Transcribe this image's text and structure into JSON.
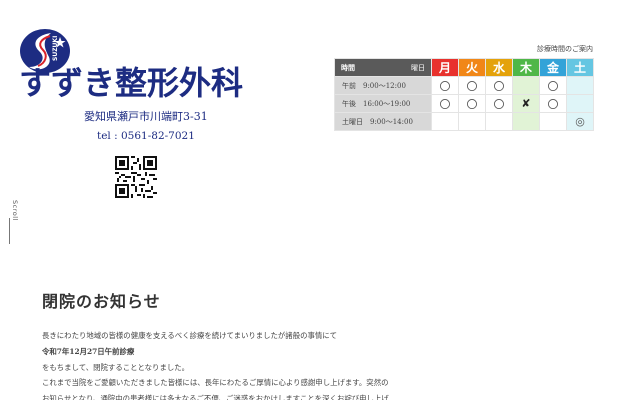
{
  "header": {
    "logo_text": "SUZUKI",
    "clinic_name": "すずき整形外科",
    "address": "愛知県瀬戸市川端町3-31",
    "tel": "tel : 0561-82-7021"
  },
  "scroll": {
    "label": "Scroll"
  },
  "schedule": {
    "caption": "診療時間のご案内",
    "header_time": "時間",
    "header_youbi": "曜日",
    "days": [
      {
        "label": "月",
        "color": "#e8312d"
      },
      {
        "label": "火",
        "color": "#f18718"
      },
      {
        "label": "水",
        "color": "#e4a20b"
      },
      {
        "label": "木",
        "color": "#4fb748"
      },
      {
        "label": "金",
        "color": "#33a3d8"
      },
      {
        "label": "土",
        "color": "#65c6e2"
      }
    ],
    "rows": [
      {
        "label": "午前　9:00～12:00",
        "marks": [
          "〇",
          "〇",
          "〇",
          "",
          "〇",
          ""
        ]
      },
      {
        "label": "午後　16:00～19:00",
        "marks": [
          "〇",
          "〇",
          "〇",
          "✘",
          "〇",
          ""
        ]
      },
      {
        "label": "土曜日　9:00～14:00",
        "marks": [
          "",
          "",
          "",
          "",
          "",
          "◎"
        ]
      }
    ]
  },
  "notice": {
    "title": "閉院のお知らせ",
    "lines": [
      "長きにわたり地域の皆様の健康を支えるべく診療を続けてまいりましたが諸般の事情にて",
      "令和7年12月27日午前診療",
      "をもちまして、閉院することとなりました。",
      "これまで当院をご愛顧いただきました皆様には、長年にわたるご厚情に心より感謝申し上げます。突然の",
      "お知らせとなり、通院中の患者様には多大なるご不便、ご迷惑をおかけしますことを深くお詫び申し上げ"
    ]
  },
  "colors": {
    "brand": "#1d2c82",
    "logo_red": "#d8232a"
  }
}
